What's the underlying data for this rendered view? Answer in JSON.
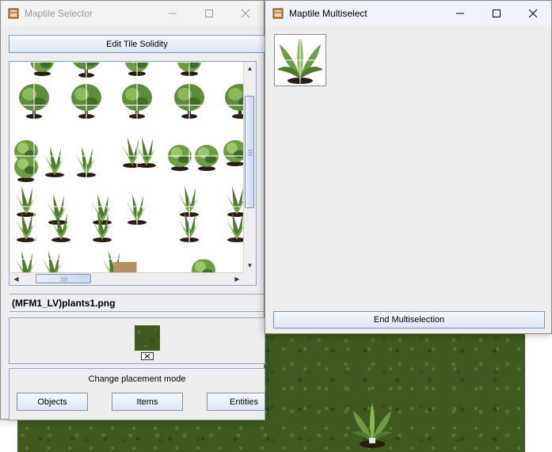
{
  "selector_window": {
    "title": "Maptile Selector",
    "icon": "window-app-icon",
    "controls": [
      "minimize-icon",
      "maximize-icon",
      "close-icon"
    ],
    "edit_solidity_button": "Edit Tile Solidity",
    "file_label": "(MFM1_LV)plants1.png",
    "selected_tile_icon": "plant-tile-icon",
    "placement_label": "Change placement mode",
    "mode_buttons": {
      "objects": "Objects",
      "items": "Items",
      "entities": "Entities"
    }
  },
  "multiselect_window": {
    "title": "Maptile Multiselect",
    "icon": "window-app-icon",
    "controls": [
      "minimize-icon",
      "maximize-icon",
      "close-icon"
    ],
    "selected_tile_icon": "plant-tile-icon",
    "end_button": "End Multiselection"
  },
  "colors": {
    "titlebar_active_text": "#000000",
    "titlebar_inactive_text": "#999999",
    "button_border": "#7b93b3",
    "grass": "#3e5a1e",
    "leaf": "#5e8c3a"
  }
}
